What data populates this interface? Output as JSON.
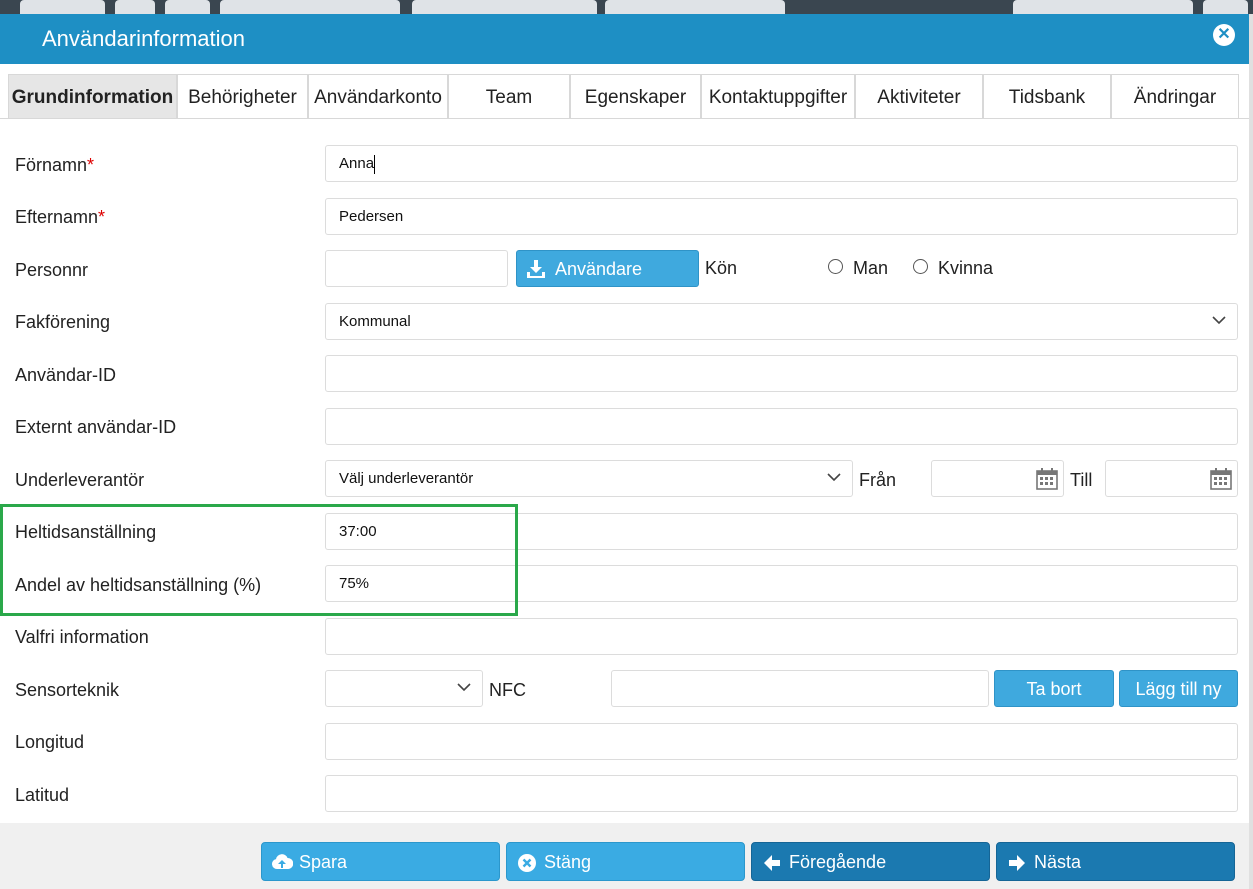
{
  "dialog": {
    "title": "Användarinformation",
    "close_icon": "close-circle-icon"
  },
  "tabs": [
    {
      "label": "Grundinformation",
      "active": true
    },
    {
      "label": "Behörigheter"
    },
    {
      "label": "Användarkonto"
    },
    {
      "label": "Team"
    },
    {
      "label": "Egenskaper"
    },
    {
      "label": "Kontaktuppgifter"
    },
    {
      "label": "Aktiviteter"
    },
    {
      "label": "Tidsbank"
    },
    {
      "label": "Ändringar"
    }
  ],
  "form": {
    "fornamn": {
      "label": "Förnamn",
      "required_mark": "*",
      "value": "Anna"
    },
    "efternamn": {
      "label": "Efternamn",
      "required_mark": "*",
      "value": "Pedersen"
    },
    "personnr": {
      "label": "Personnr",
      "value": "",
      "import_button": "Användare",
      "import_icon": "download-icon"
    },
    "kon": {
      "label": "Kön",
      "options": [
        "Man",
        "Kvinna"
      ]
    },
    "fakforening": {
      "label": "Fakförening",
      "value": "Kommunal"
    },
    "anvandar_id": {
      "label": "Användar-ID",
      "value": ""
    },
    "externt_id": {
      "label": "Externt användar-ID",
      "value": ""
    },
    "underleverantor": {
      "label": "Underleverantör",
      "placeholder": "Välj underleverantör",
      "from_label": "Från",
      "to_label": "Till",
      "calendar_icon": "calendar-icon"
    },
    "heltid": {
      "label": "Heltidsanställning",
      "value": "37:00"
    },
    "andel": {
      "label": "Andel av heltidsanställning (%)",
      "value": "75%"
    },
    "valfri": {
      "label": "Valfri information",
      "value": ""
    },
    "sensorteknik": {
      "label": "Sensorteknik",
      "value": "",
      "nfc_label": "NFC",
      "nfc_value": "",
      "remove_button": "Ta bort",
      "add_button": "Lägg till ny"
    },
    "longitud": {
      "label": "Longitud",
      "value": ""
    },
    "latitud": {
      "label": "Latitud",
      "value": ""
    }
  },
  "footer": {
    "save": {
      "label": "Spara",
      "icon": "cloud-upload-icon"
    },
    "close": {
      "label": "Stäng",
      "icon": "close-circle-icon"
    },
    "previous": {
      "label": "Föregående",
      "icon": "arrow-left-icon"
    },
    "next": {
      "label": "Nästa",
      "icon": "arrow-right-icon"
    }
  },
  "colors": {
    "titlebar": "#1e8fc4",
    "button_light": "#3aabe3",
    "button_dark": "#1b79b0",
    "highlight": "#2aa84a",
    "required": "#dd0000"
  }
}
